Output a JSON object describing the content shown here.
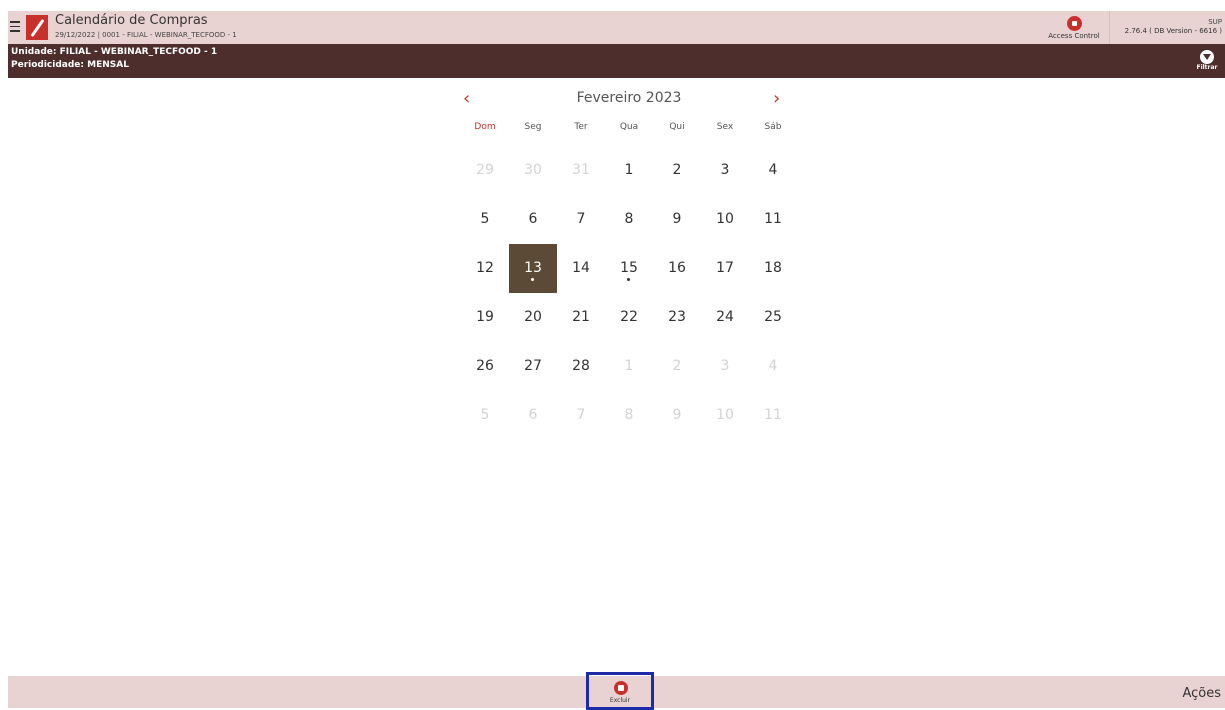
{
  "header": {
    "title": "Calendário de Compras",
    "subtitle": "29/12/2022 | 0001 - FILIAL - WEBINAR_TECFOOD - 1",
    "access_control": "Access Control",
    "sup": "SUP",
    "version": "2.76.4 ( DB Version - 6616 )"
  },
  "subheader": {
    "unidade": "Unidade: FILIAL - WEBINAR_TECFOOD - 1",
    "periodicidade": "Periodicidade: MENSAL",
    "filter_label": "Filtrar"
  },
  "calendar": {
    "prev": "‹",
    "next": "›",
    "month_label": "Fevereiro 2023",
    "weekdays": [
      "Dom",
      "Seg",
      "Ter",
      "Qua",
      "Qui",
      "Sex",
      "Sáb"
    ],
    "weeks": [
      [
        {
          "d": "29",
          "out": true
        },
        {
          "d": "30",
          "out": true
        },
        {
          "d": "31",
          "out": true
        },
        {
          "d": "1"
        },
        {
          "d": "2"
        },
        {
          "d": "3"
        },
        {
          "d": "4"
        }
      ],
      [
        {
          "d": "5"
        },
        {
          "d": "6"
        },
        {
          "d": "7"
        },
        {
          "d": "8"
        },
        {
          "d": "9"
        },
        {
          "d": "10"
        },
        {
          "d": "11"
        }
      ],
      [
        {
          "d": "12"
        },
        {
          "d": "13",
          "selected": true,
          "dot": true
        },
        {
          "d": "14"
        },
        {
          "d": "15",
          "dot": true
        },
        {
          "d": "16"
        },
        {
          "d": "17"
        },
        {
          "d": "18"
        }
      ],
      [
        {
          "d": "19"
        },
        {
          "d": "20"
        },
        {
          "d": "21"
        },
        {
          "d": "22"
        },
        {
          "d": "23"
        },
        {
          "d": "24"
        },
        {
          "d": "25"
        }
      ],
      [
        {
          "d": "26"
        },
        {
          "d": "27"
        },
        {
          "d": "28"
        },
        {
          "d": "1",
          "out": true
        },
        {
          "d": "2",
          "out": true
        },
        {
          "d": "3",
          "out": true
        },
        {
          "d": "4",
          "out": true
        }
      ],
      [
        {
          "d": "5",
          "out": true
        },
        {
          "d": "6",
          "out": true
        },
        {
          "d": "7",
          "out": true
        },
        {
          "d": "8",
          "out": true
        },
        {
          "d": "9",
          "out": true
        },
        {
          "d": "10",
          "out": true
        },
        {
          "d": "11",
          "out": true
        }
      ]
    ]
  },
  "footer": {
    "excluir": "Excluir",
    "acoes": "Ações"
  },
  "colors": {
    "accent": "#c8302c",
    "header_bg": "#e8d3d2",
    "subheader_bg": "#4e2d2d",
    "selected_day": "#5a4a36",
    "highlight_box": "#1e2aa8"
  }
}
